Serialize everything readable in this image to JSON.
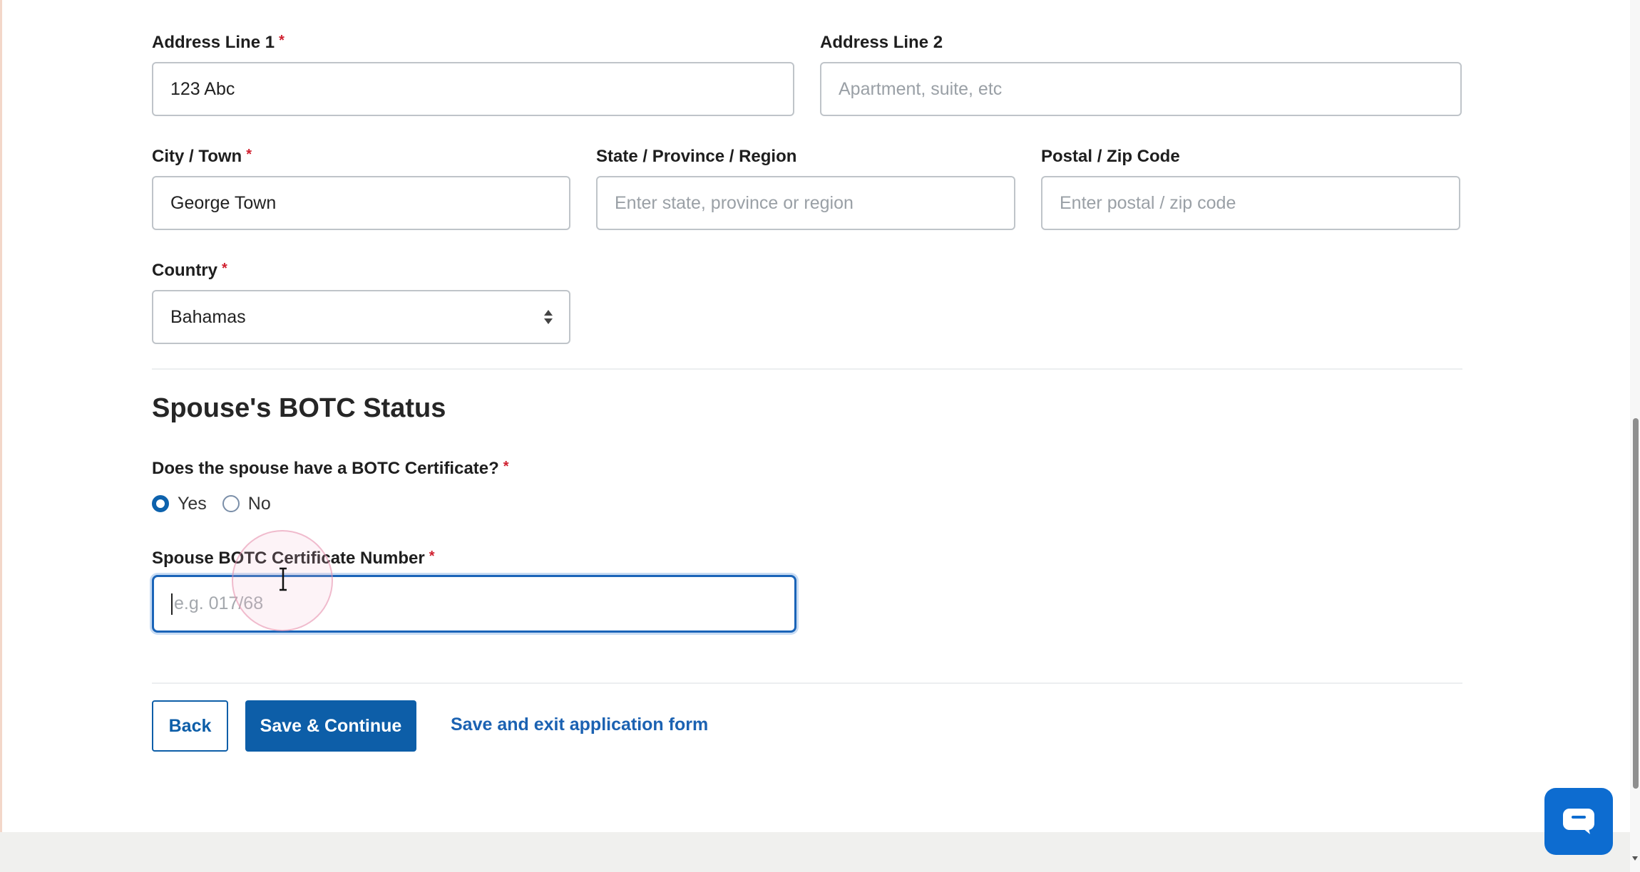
{
  "address": {
    "line1": {
      "label": "Address Line 1",
      "required": "*",
      "value": "123 Abc"
    },
    "line2": {
      "label": "Address Line 2",
      "placeholder": "Apartment, suite, etc"
    },
    "city": {
      "label": "City / Town",
      "required": "*",
      "value": "George Town"
    },
    "state": {
      "label": "State / Province / Region",
      "placeholder": "Enter state, province or region"
    },
    "postal": {
      "label": "Postal / Zip Code",
      "placeholder": "Enter postal / zip code"
    },
    "country": {
      "label": "Country",
      "required": "*",
      "value": "Bahamas"
    }
  },
  "spouse": {
    "section_title": "Spouse's BOTC Status",
    "question": "Does the spouse have a BOTC Certificate?",
    "required": "*",
    "options": [
      {
        "label": "Yes",
        "checked": true
      },
      {
        "label": "No",
        "checked": false
      }
    ],
    "cert": {
      "label": "Spouse BOTC Certificate Number",
      "required": "*",
      "placeholder": "e.g. 017/68"
    }
  },
  "actions": {
    "back": "Back",
    "save_continue": "Save & Continue",
    "save_exit": "Save and exit application form"
  },
  "colors": {
    "primary": "#0d5ea8",
    "required": "#d0202f",
    "chat": "#0d6cd0"
  },
  "icons": {
    "select": "select-arrows-icon",
    "chat": "chat-bubble-icon",
    "cursor": "text-cursor-icon"
  }
}
